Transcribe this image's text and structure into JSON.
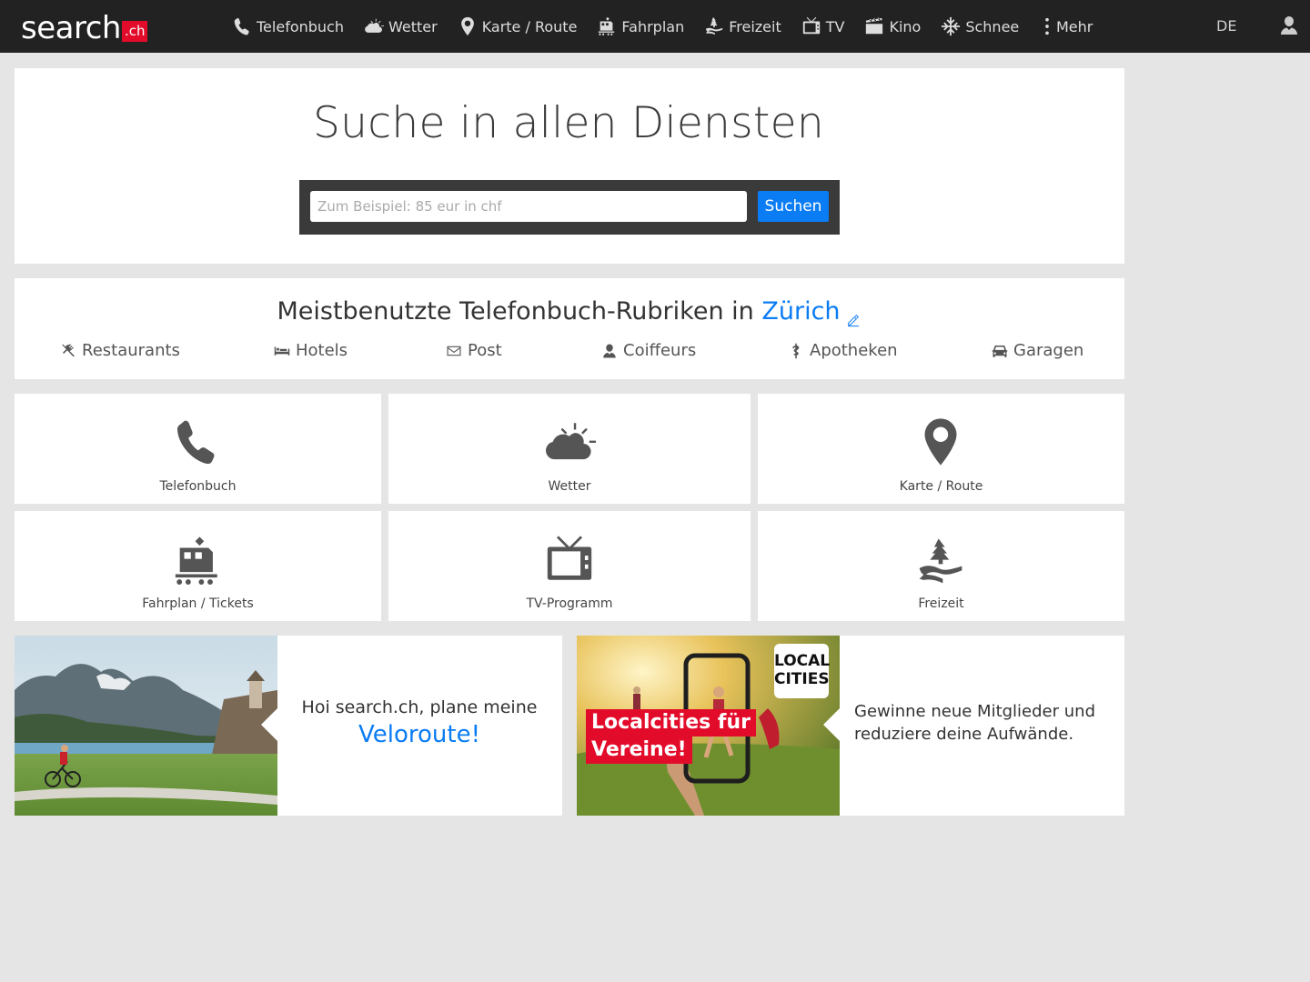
{
  "header": {
    "logo_word": "search",
    "logo_tld": ".ch",
    "nav": [
      {
        "label": "Telefonbuch",
        "icon": "phone-icon"
      },
      {
        "label": "Wetter",
        "icon": "weather-icon"
      },
      {
        "label": "Karte / Route",
        "icon": "map-pin-icon"
      },
      {
        "label": "Fahrplan",
        "icon": "train-icon"
      },
      {
        "label": "Freizeit",
        "icon": "leisure-icon"
      },
      {
        "label": "TV",
        "icon": "tv-icon"
      },
      {
        "label": "Kino",
        "icon": "cinema-icon"
      },
      {
        "label": "Schnee",
        "icon": "snowflake-icon"
      }
    ],
    "more_label": "Mehr",
    "language": "DE"
  },
  "search": {
    "title": "Suche in allen Diensten",
    "placeholder": "Zum Beispiel: 85 eur in chf",
    "button_label": "Suchen"
  },
  "rubrics": {
    "title_prefix": "Meistbenutzte Telefonbuch-Rubriken in",
    "city": "Zürich",
    "items": [
      {
        "label": "Restaurants",
        "icon": "cutlery-icon"
      },
      {
        "label": "Hotels",
        "icon": "bed-icon"
      },
      {
        "label": "Post",
        "icon": "envelope-icon"
      },
      {
        "label": "Coiffeurs",
        "icon": "person-icon"
      },
      {
        "label": "Apotheken",
        "icon": "pharmacy-icon"
      },
      {
        "label": "Garagen",
        "icon": "car-icon"
      }
    ]
  },
  "tiles": [
    {
      "label": "Telefonbuch",
      "icon": "phone-icon"
    },
    {
      "label": "Wetter",
      "icon": "weather-icon"
    },
    {
      "label": "Karte / Route",
      "icon": "map-pin-icon"
    },
    {
      "label": "Fahrplan / Tickets",
      "icon": "train-icon"
    },
    {
      "label": "TV-Programm",
      "icon": "tv-icon"
    },
    {
      "label": "Freizeit",
      "icon": "leisure-icon"
    }
  ],
  "promos": {
    "velo": {
      "text": "Hoi search.ch, plane meine",
      "link": "Veloroute!"
    },
    "localcities": {
      "badge_line1": "Localcities für",
      "badge_line2": "Vereine!",
      "logo_line1": "LOCAL",
      "logo_line2": "CITIES",
      "text": "Gewinne neue Mitglieder und reduziere deine Aufwände."
    }
  },
  "colors": {
    "accent": "#0a7cf4",
    "brand_red": "#e30b2a",
    "header_bg": "#222222",
    "page_bg": "#e5e5e5"
  }
}
